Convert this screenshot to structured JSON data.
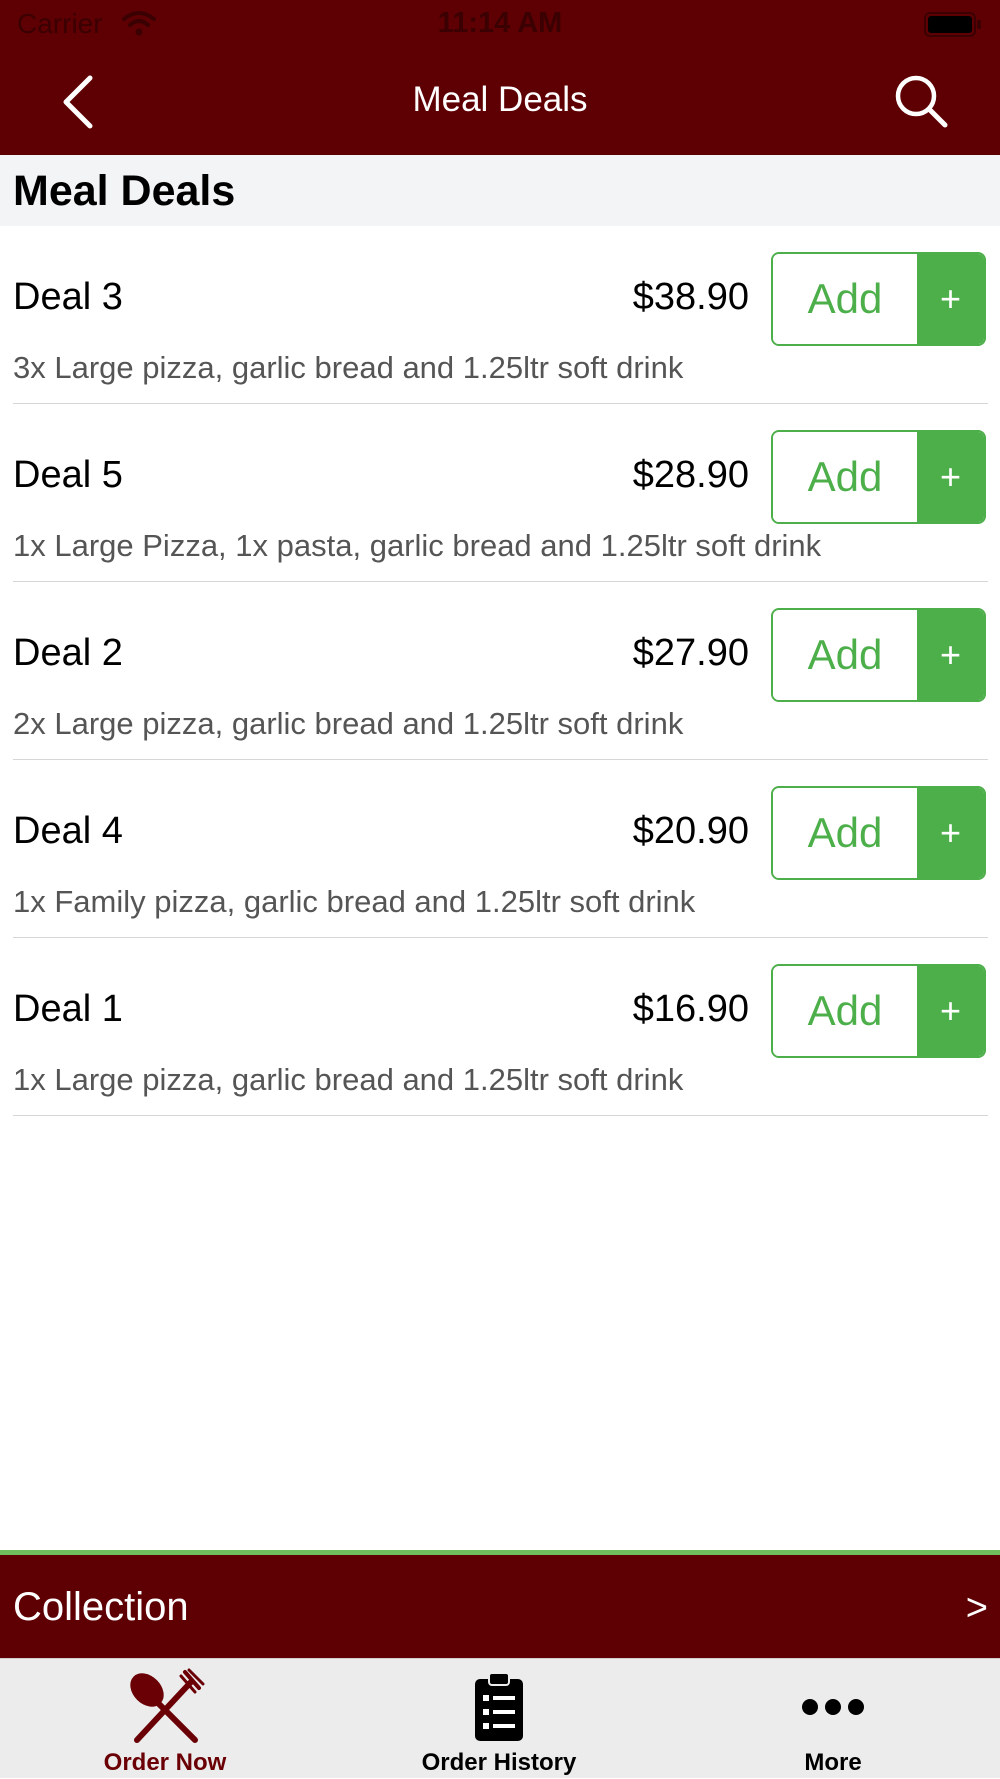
{
  "status_bar": {
    "carrier": "Carrier",
    "time": "11:14 AM"
  },
  "nav": {
    "title": "Meal Deals",
    "back_icon": "chevron-left-icon",
    "search_icon": "search-icon"
  },
  "section": {
    "title": "Meal Deals"
  },
  "items": [
    {
      "name": "Deal 3",
      "price": "$38.90",
      "description": "3x Large pizza, garlic bread and 1.25ltr soft drink",
      "add_label": "Add",
      "plus_label": "+"
    },
    {
      "name": "Deal 5",
      "price": "$28.90",
      "description": "1x Large Pizza, 1x pasta, garlic bread and 1.25ltr soft drink",
      "add_label": "Add",
      "plus_label": "+"
    },
    {
      "name": "Deal 2",
      "price": "$27.90",
      "description": "2x Large pizza, garlic bread and 1.25ltr soft drink",
      "add_label": "Add",
      "plus_label": "+"
    },
    {
      "name": "Deal 4",
      "price": "$20.90",
      "description": "1x Family pizza, garlic bread and 1.25ltr soft drink",
      "add_label": "Add",
      "plus_label": "+"
    },
    {
      "name": "Deal 1",
      "price": "$16.90",
      "description": "1x Large pizza, garlic bread and 1.25ltr soft drink",
      "add_label": "Add",
      "plus_label": "+"
    }
  ],
  "collection": {
    "label": "Collection",
    "arrow": ">"
  },
  "tabs": [
    {
      "label": "Order Now",
      "icon": "fork-spoon-icon",
      "active": true
    },
    {
      "label": "Order History",
      "icon": "clipboard-icon",
      "active": false
    },
    {
      "label": "More",
      "icon": "more-dots-icon",
      "active": false
    }
  ],
  "colors": {
    "brand": "#5e0003",
    "accent": "#4caf4a",
    "active_tab": "#6a0005"
  }
}
